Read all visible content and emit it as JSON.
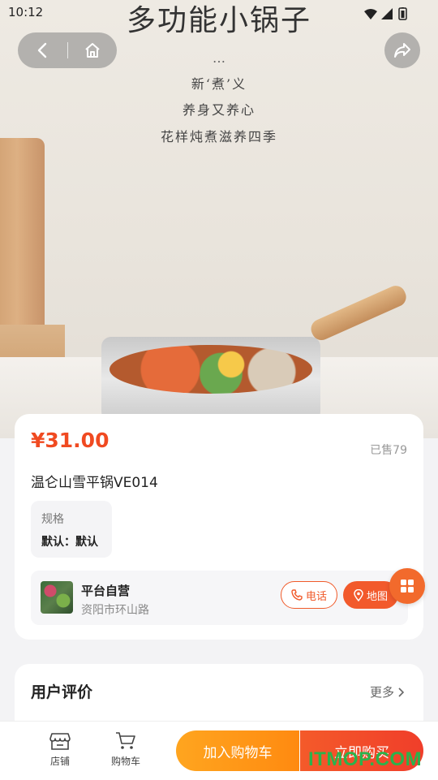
{
  "status_bar": {
    "time": "10:12"
  },
  "hero": {
    "title": "多功能小锅子",
    "dots": "…",
    "line1": "新‘煮’义",
    "line2": "养身又养心",
    "line3": "花样炖煮滋养四季"
  },
  "product": {
    "price": "¥31.00",
    "sold": "已售79",
    "name": "温仑山雪平锅VE014",
    "spec_label": "规格",
    "spec_value": "默认：默认"
  },
  "shop": {
    "name": "平台自营",
    "address": "资阳市环山路",
    "phone_label": "电话",
    "map_label": "地图"
  },
  "reviews": {
    "title": "用户评价",
    "more": "更多"
  },
  "bottom_bar": {
    "store_label": "店铺",
    "cart_label": "购物车",
    "add_to_cart": "加入购物车",
    "buy_now": "立即购买"
  },
  "watermark": "ITMOP.COM",
  "colors": {
    "accent": "#f04a21",
    "orange": "#ff8a10"
  }
}
